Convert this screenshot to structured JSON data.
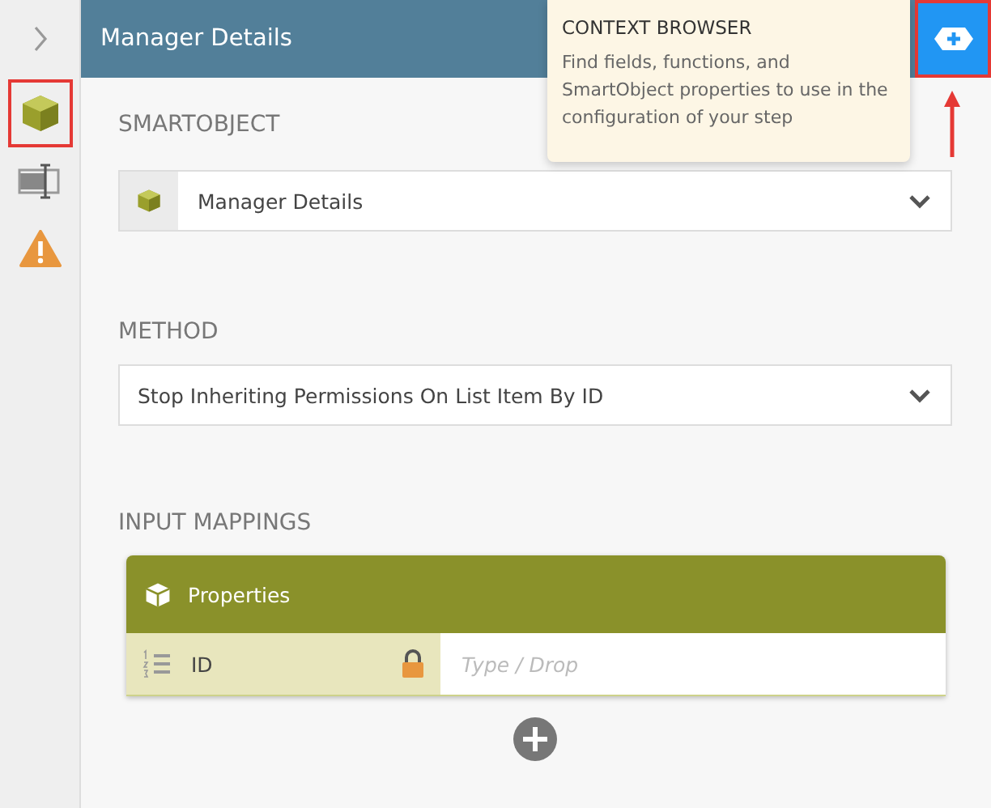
{
  "sidebar": {
    "items": [
      {
        "kind": "smartobject",
        "highlighted": true
      },
      {
        "kind": "field",
        "highlighted": false
      },
      {
        "kind": "warning",
        "highlighted": false
      }
    ]
  },
  "header": {
    "title": "Manager Details",
    "context_button": {
      "highlighted": true
    }
  },
  "tooltip": {
    "title": "CONTEXT BROWSER",
    "text": "Find fields, functions, and SmartObject properties to use in the configuration of your step"
  },
  "smartobject": {
    "label": "SMARTOBJECT",
    "value": "Manager Details"
  },
  "method": {
    "label": "METHOD",
    "value": "Stop Inheriting Permissions On List Item By ID"
  },
  "input_mappings": {
    "label": "INPUT MAPPINGS",
    "title": "Properties",
    "rows": [
      {
        "name": "ID",
        "locked": true,
        "placeholder": "Type / Drop"
      }
    ]
  }
}
